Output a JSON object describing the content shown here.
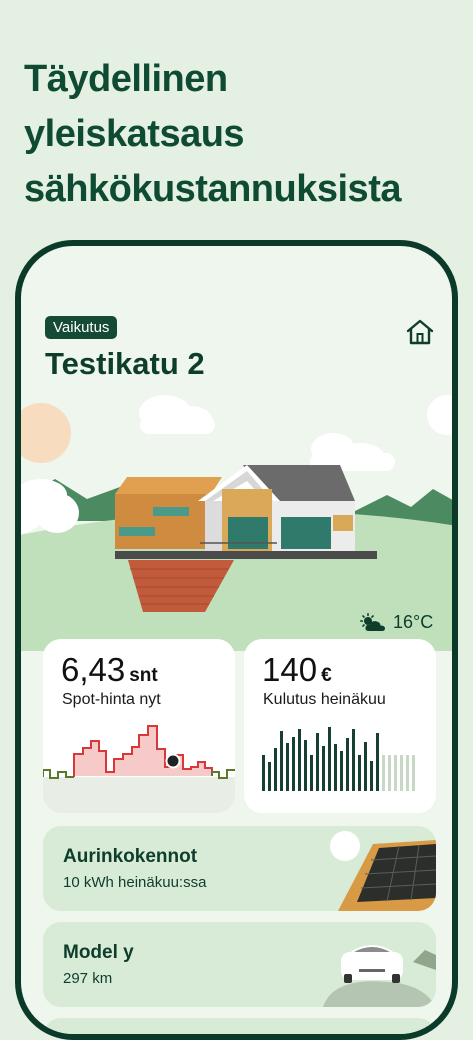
{
  "headline": {
    "lines": [
      "Täydellinen",
      "yleiskatsaus",
      "sähkökustannuksista"
    ]
  },
  "property": {
    "badge": "Vaikutus",
    "address": "Testikatu 2"
  },
  "weather": {
    "icon": "partly-cloudy-icon",
    "temperature": "16°C"
  },
  "spot_card": {
    "value": "6,43",
    "unit": "snt",
    "label": "Spot-hinta nyt"
  },
  "cost_card": {
    "value": "140",
    "unit": "€",
    "label": "Kulutus heinäkuu"
  },
  "solar_card": {
    "title": "Aurinkokennot",
    "subtitle": "10 kWh heinäkuu:ssa"
  },
  "car_card": {
    "title": "Model y",
    "subtitle": "297 km"
  },
  "colors": {
    "primary": "#0f4a33",
    "background": "#e3f0e2",
    "price_high": "#d9383a",
    "price_low": "#5a7a2a"
  }
}
